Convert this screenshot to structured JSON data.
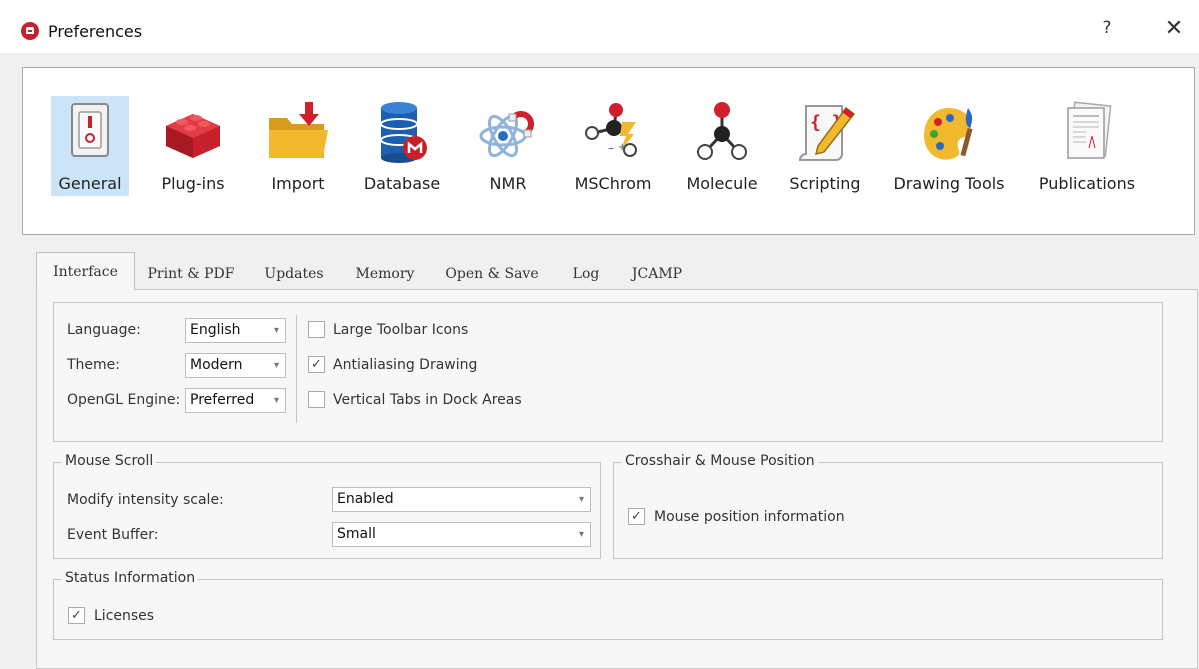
{
  "window": {
    "title": "Preferences",
    "help_label": "?",
    "close_label": "✕"
  },
  "categories": [
    {
      "label": "General",
      "icon": "general-icon"
    },
    {
      "label": "Plug-ins",
      "icon": "plugins-icon"
    },
    {
      "label": "Import",
      "icon": "import-icon"
    },
    {
      "label": "Database",
      "icon": "database-icon"
    },
    {
      "label": "NMR",
      "icon": "nmr-icon"
    },
    {
      "label": "MSChrom",
      "icon": "mschrom-icon"
    },
    {
      "label": "Molecule",
      "icon": "molecule-icon"
    },
    {
      "label": "Scripting",
      "icon": "scripting-icon"
    },
    {
      "label": "Drawing Tools",
      "icon": "drawing-tools-icon"
    },
    {
      "label": "Publications",
      "icon": "publications-icon"
    }
  ],
  "selected_category": "General",
  "tabs": [
    "Interface",
    "Print & PDF",
    "Updates",
    "Memory",
    "Open & Save",
    "Log",
    "JCAMP"
  ],
  "active_tab": "Interface",
  "interface": {
    "language_label": "Language:",
    "language_value": "English",
    "theme_label": "Theme:",
    "theme_value": "Modern",
    "opengl_label": "OpenGL Engine:",
    "opengl_value": "Preferred",
    "large_toolbar_label": "Large Toolbar Icons",
    "large_toolbar_checked": false,
    "antialiasing_label": "Antialiasing Drawing",
    "antialiasing_checked": true,
    "vertical_tabs_label": "Vertical Tabs in Dock Areas",
    "vertical_tabs_checked": false
  },
  "mouse_scroll": {
    "title": "Mouse Scroll",
    "modify_label": "Modify intensity scale:",
    "modify_value": "Enabled",
    "buffer_label": "Event Buffer:",
    "buffer_value": "Small"
  },
  "crosshair": {
    "title": "Crosshair & Mouse Position",
    "mouse_position_label": "Mouse position information",
    "mouse_position_checked": true
  },
  "status": {
    "title": "Status Information",
    "licenses_label": "Licenses",
    "licenses_checked": true
  },
  "check_mark": "✓",
  "dropdown_arrow": "▾"
}
